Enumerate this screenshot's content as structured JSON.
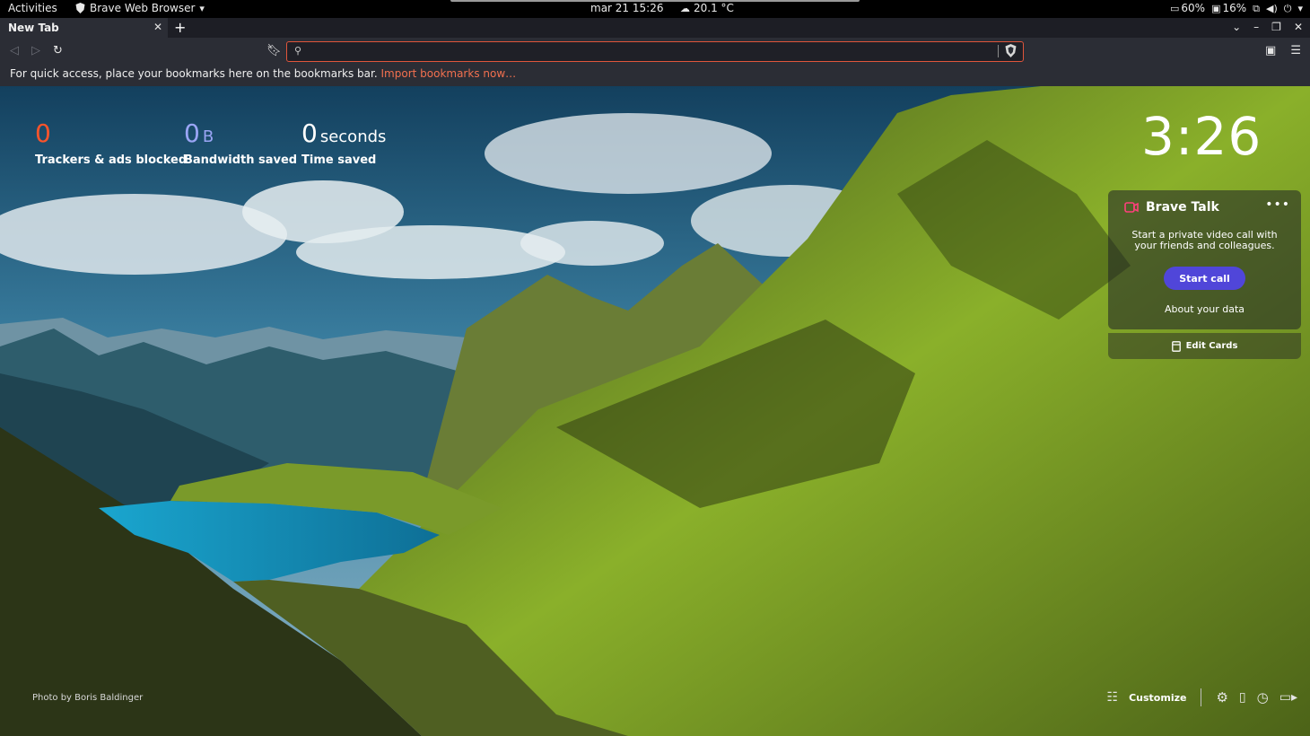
{
  "gnome": {
    "activities": "Activities",
    "app_name": "Brave Web Browser",
    "datetime": "mar 21  15:26",
    "weather": "20.1 °C",
    "battery": "60%",
    "storage": "16%"
  },
  "browser": {
    "tab_title": "New Tab",
    "omnibox_value": "",
    "bookmarks_hint": "For quick access, place your bookmarks here on the bookmarks bar.",
    "import_link": "Import bookmarks now…",
    "accent_color": "#f2704f"
  },
  "stats": {
    "trackers_count": "0",
    "trackers_label": "Trackers & ads blocked",
    "bandwidth_count": "0",
    "bandwidth_unit": "B",
    "bandwidth_label": "Bandwidth saved",
    "time_count": "0",
    "time_unit": "seconds",
    "time_label": "Time saved"
  },
  "clock": "3:26",
  "brave_talk": {
    "title": "Brave Talk",
    "description": "Start a private video call with your friends and colleagues.",
    "start_button": "Start call",
    "about_link": "About your data",
    "edit_cards": "Edit Cards"
  },
  "footer": {
    "photo_credit": "Photo by Boris Baldinger",
    "customize": "Customize"
  },
  "icons": [
    "brave-shield-icon",
    "chevron-down-icon",
    "cloud-icon",
    "battery-icon",
    "disk-icon",
    "network-icon",
    "volume-icon",
    "power-icon",
    "close-icon",
    "plus-icon",
    "minimize-icon",
    "restore-icon",
    "back-icon",
    "forward-icon",
    "reload-icon",
    "bookmark-icon",
    "search-icon",
    "wallet-icon",
    "menu-icon",
    "video-camera-icon",
    "more-icon",
    "customize-icon",
    "settings-icon",
    "bookmarks-icon",
    "history-icon",
    "brave-talk-icon"
  ]
}
